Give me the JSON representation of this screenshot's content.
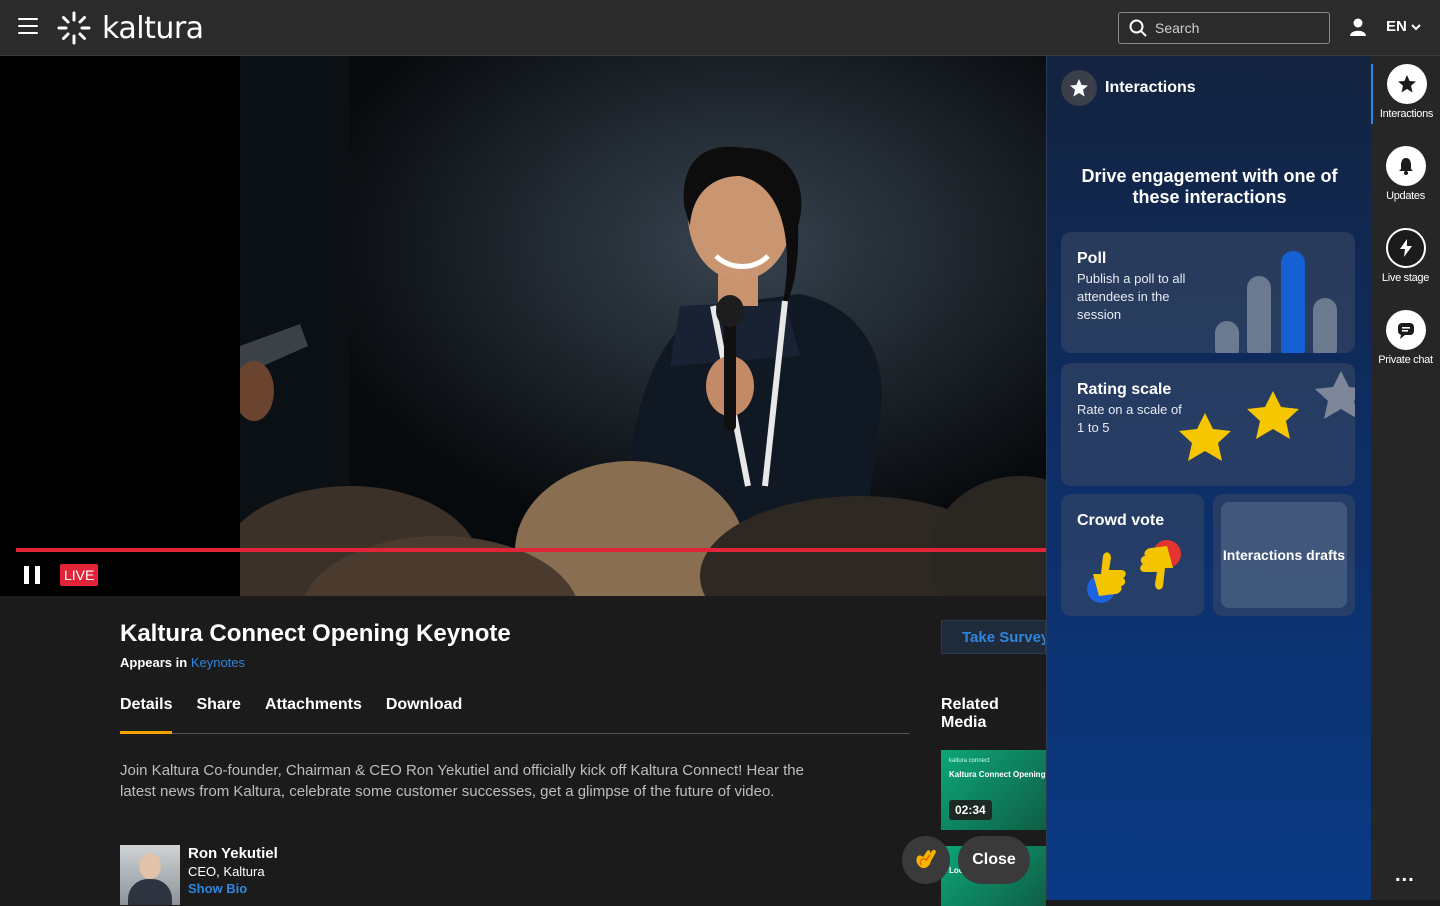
{
  "header": {
    "brand": "kaltura",
    "search_placeholder": "Search",
    "language": "EN"
  },
  "player": {
    "live_label": "LIVE"
  },
  "entry": {
    "title": "Kaltura Connect Opening Keynote",
    "appears_in_label": "Appears in",
    "appears_in_link": "Keynotes",
    "survey_button": "Take Survey",
    "tabs": [
      {
        "label": "Details",
        "active": true
      },
      {
        "label": "Share",
        "active": false
      },
      {
        "label": "Attachments",
        "active": false
      },
      {
        "label": "Download",
        "active": false
      }
    ],
    "description": "Join Kaltura Co-founder, Chairman & CEO Ron Yekutiel and officially kick off Kaltura Connect! Hear the latest news from Kaltura, celebrate some customer successes, get a glimpse of the future of video.",
    "presenter": {
      "name": "Ron Yekutiel",
      "role": "CEO, Kaltura",
      "bio_link": "Show Bio"
    },
    "related_label": "Related Media",
    "related": [
      {
        "brand": "kaltura connect",
        "title": "Kaltura Connect Opening Keynote",
        "duration": "02:34"
      },
      {
        "title": "Loo"
      }
    ],
    "close_button": "Close"
  },
  "interactions_panel": {
    "title": "Interactions",
    "headline": "Drive engagement with one of these interactions",
    "cards": {
      "poll": {
        "title": "Poll",
        "desc": "Publish a poll to all attendees in the session"
      },
      "rating": {
        "title": "Rating scale",
        "desc": "Rate on a scale of 1 to 5"
      },
      "crowd": {
        "title": "Crowd vote"
      },
      "drafts": {
        "title": "Interactions drafts"
      }
    }
  },
  "rail": {
    "items": [
      {
        "label": "Interactions",
        "icon": "star-icon"
      },
      {
        "label": "Updates",
        "icon": "bell-icon"
      },
      {
        "label": "Live stage",
        "icon": "bolt-icon"
      },
      {
        "label": "Private chat",
        "icon": "chat-icon"
      }
    ],
    "more": "..."
  },
  "colors": {
    "accent_blue": "#2e86de",
    "live_red": "#e12437",
    "tab_underline": "#f6a300",
    "panel_blue": "#0a3a85"
  }
}
